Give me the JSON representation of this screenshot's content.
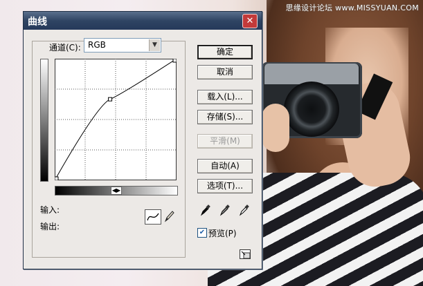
{
  "watermark": "思缘设计论坛 www.MISSYUAN.COM",
  "dialog": {
    "title": "曲线",
    "close_label": "✕",
    "channel_label": "通道(C):",
    "channel_value": "RGB",
    "input_label": "输入:",
    "output_label": "输出:"
  },
  "buttons": {
    "ok": "确定",
    "cancel": "取消",
    "load": "载入(L)...",
    "save": "存储(S)...",
    "smooth": "平滑(M)",
    "auto": "自动(A)",
    "options": "选项(T)..."
  },
  "preview": {
    "label": "预览(P)",
    "checked": true
  },
  "curve": {
    "points": [
      [
        0,
        0
      ],
      [
        116,
        170
      ],
      [
        255,
        255
      ]
    ]
  },
  "colors": {
    "accent": "#2f4463",
    "close": "#c23a3a"
  }
}
